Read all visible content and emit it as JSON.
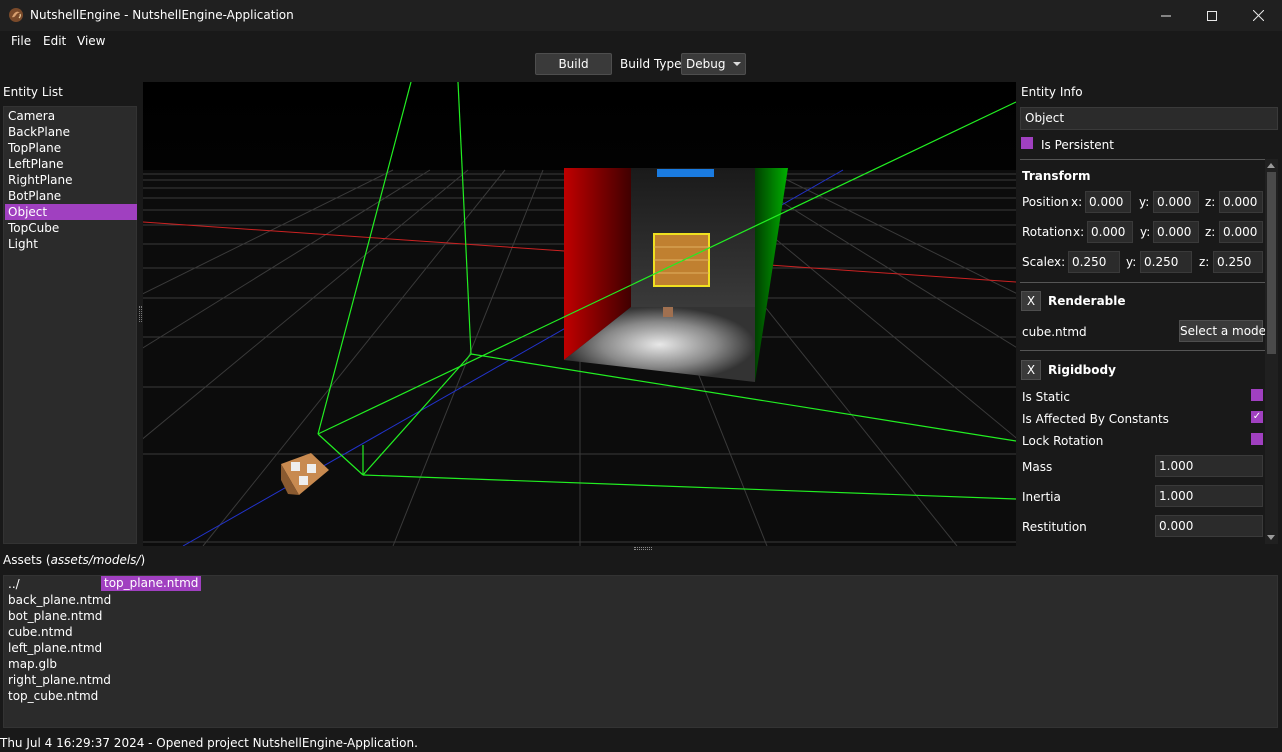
{
  "window": {
    "title": "NutshellEngine - NutshellEngine-Application",
    "icon": "nutshell-icon",
    "controls": [
      "minimize-icon",
      "maximize-icon",
      "close-icon"
    ]
  },
  "menu": {
    "file": "File",
    "edit": "Edit",
    "view": "View"
  },
  "toolbar": {
    "build_label": "Build",
    "build_type_label": "Build Type",
    "build_type_value": "Debug"
  },
  "entity_list": {
    "title": "Entity List",
    "items": [
      "Camera",
      "BackPlane",
      "TopPlane",
      "LeftPlane",
      "RightPlane",
      "BotPlane",
      "Object",
      "TopCube",
      "Light"
    ],
    "selected": "Object"
  },
  "entity_info": {
    "title": "Entity Info",
    "name": "Object",
    "persistent_label": "Is Persistent",
    "transform": {
      "title": "Transform",
      "position_label": "Position",
      "rotation_label": "Rotation",
      "scale_label": "Scale",
      "axis_x": "x:",
      "axis_y": "y:",
      "axis_z": "z:",
      "position": [
        "0.000",
        "0.000",
        "0.000"
      ],
      "rotation": [
        "0.000",
        "0.000",
        "0.000"
      ],
      "scale": [
        "0.250",
        "0.250",
        "0.250"
      ]
    },
    "renderable": {
      "remove_label": "X",
      "title": "Renderable",
      "model": "cube.ntmd",
      "select_model_label": "Select a model"
    },
    "rigidbody": {
      "remove_label": "X",
      "title": "Rigidbody",
      "is_static_label": "Is Static",
      "affected_label": "Is Affected By Constants",
      "affected_check": "✓",
      "lock_rotation_label": "Lock Rotation",
      "mass_label": "Mass",
      "mass": "1.000",
      "inertia_label": "Inertia",
      "inertia": "1.000",
      "restitution_label": "Restitution",
      "restitution": "0.000"
    }
  },
  "assets": {
    "title_prefix": "Assets (",
    "path": "assets/models/",
    "title_suffix": ")",
    "items": [
      "../",
      "back_plane.ntmd",
      "bot_plane.ntmd",
      "cube.ntmd",
      "left_plane.ntmd",
      "map.glb",
      "right_plane.ntmd",
      "top_cube.ntmd"
    ],
    "selected": "top_plane.ntmd"
  },
  "status": {
    "message": "Thu Jul  4 16:29:37 2024 - Opened project NutshellEngine-Application."
  },
  "colors": {
    "accent": "#a040c0",
    "background": "#191919",
    "panel": "#2b2b2b",
    "grid": "#3a3a3a",
    "bounding_box": "#22ee22",
    "x_axis": "#cc2222",
    "z_axis": "#2233cc",
    "selection_outline": "#f0e020"
  }
}
